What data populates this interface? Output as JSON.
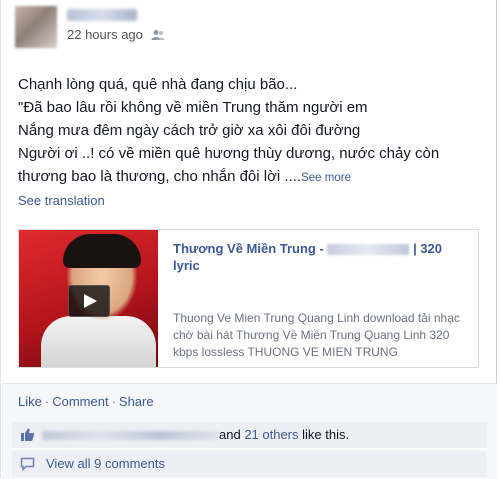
{
  "post": {
    "timestamp": "22 hours ago",
    "audience_icon": "friends-icon",
    "message_lines": [
      "Chạnh lòng quá, quê nhà đang chịu bão...",
      "\"Đã bao lâu rồi không về miền Trung thăm người em",
      "Nắng mưa đêm ngày cách trở giờ xa xôi đôi đường",
      "Người ơi ..! có về miền quê hương thùy dương, nước chảy còn",
      "thương bao là thương, cho nhắn đôi lời ...."
    ],
    "see_more": "See more",
    "see_translation": "See translation"
  },
  "share_card": {
    "title_part1": "Thương Về Miền Trung -",
    "title_part2": "| 320",
    "title_line2": "lyric",
    "description": "Thuong Ve Mien Trung Quang Linh download tải nhạc chờ bài hát Thương Về Miền Trung Quang Linh 320 kbps lossless THUONG VE MIEN TRUNG",
    "play_icon": "play-icon"
  },
  "actions": {
    "like": "Like",
    "comment": "Comment",
    "share": "Share",
    "separator": "·"
  },
  "likes": {
    "icon": "thumbs-up-icon",
    "text_and": "and ",
    "others_link": "21 others",
    "text_suffix": " like this."
  },
  "comments": {
    "icon": "comment-icon",
    "view_all": "View all 9 comments"
  },
  "colors": {
    "link": "#3b5998",
    "footer_bg": "#f6f7f9",
    "row_bg": "#edeff4"
  }
}
